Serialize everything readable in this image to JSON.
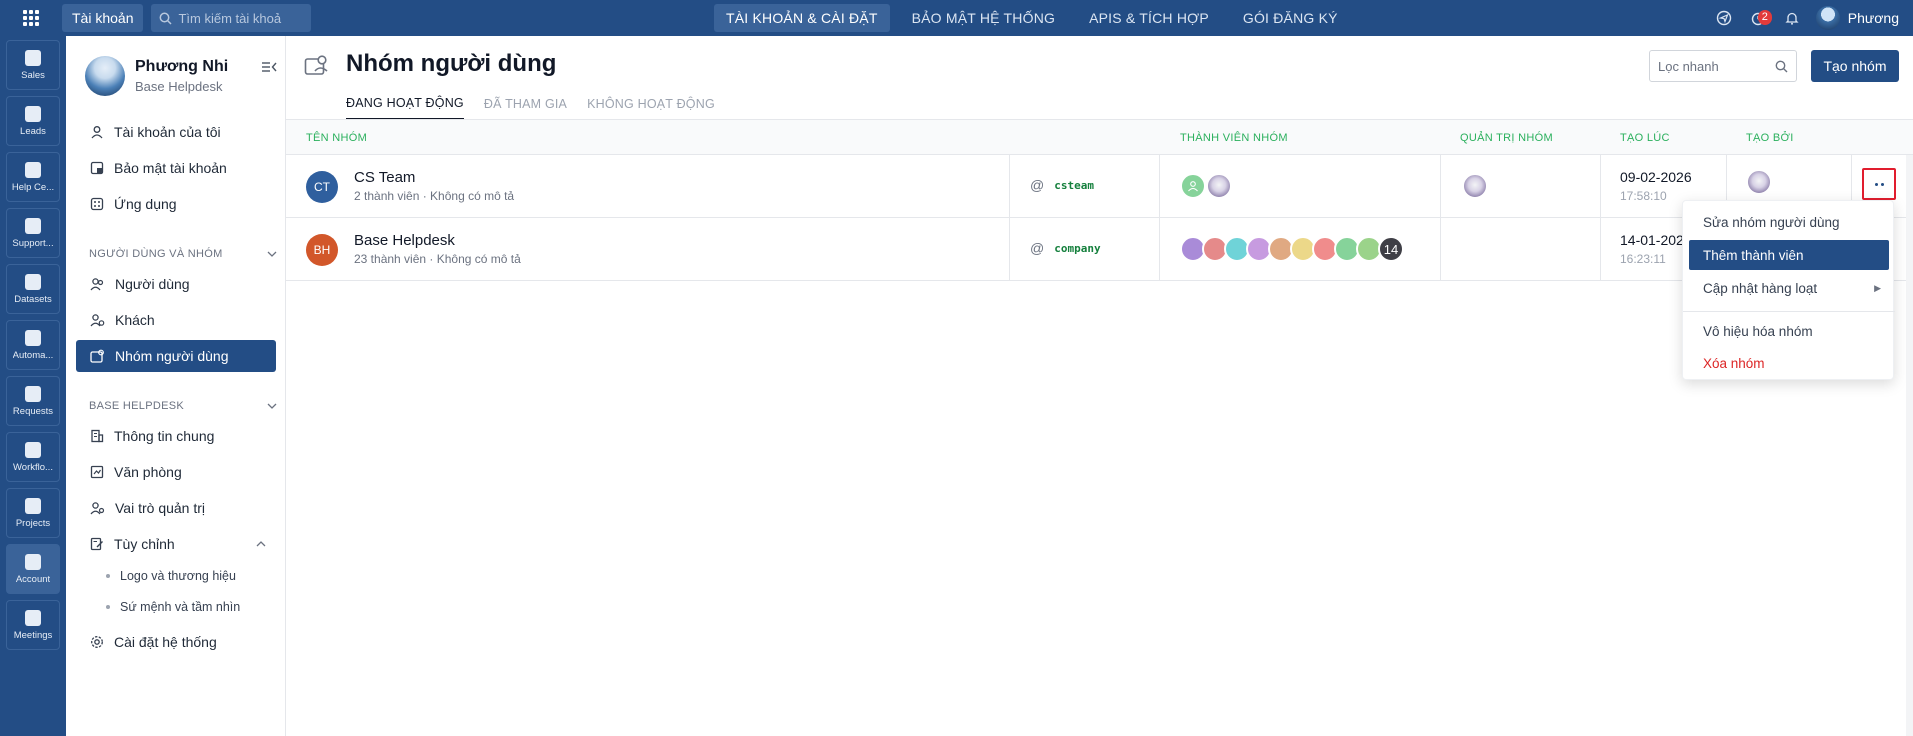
{
  "topbar": {
    "account_chip": "Tài khoản",
    "search_placeholder": "Tìm kiếm tài khoả",
    "nav": [
      {
        "label": "TÀI KHOẢN & CÀI ĐẶT",
        "active": true
      },
      {
        "label": "BẢO MẬT HỆ THỐNG",
        "active": false
      },
      {
        "label": "APIS & TÍCH HỢP",
        "active": false
      },
      {
        "label": "GÓI ĐĂNG KÝ",
        "active": false
      }
    ],
    "notification_count": "2",
    "user_name": "Phương"
  },
  "rail": [
    {
      "label": "Sales"
    },
    {
      "label": "Leads"
    },
    {
      "label": "Help Ce..."
    },
    {
      "label": "Support..."
    },
    {
      "label": "Datasets"
    },
    {
      "label": "Automa..."
    },
    {
      "label": "Requests"
    },
    {
      "label": "Workflo..."
    },
    {
      "label": "Projects"
    },
    {
      "label": "Account",
      "active": true
    },
    {
      "label": "Meetings"
    }
  ],
  "sidebar": {
    "profile_name": "Phương Nhi",
    "profile_sub": "Base Helpdesk",
    "items_top": [
      "Tài khoản của tôi",
      "Bảo mật tài khoản",
      "Ứng dụng"
    ],
    "section_users": "NGƯỜI DÙNG VÀ NHÓM",
    "items_users": [
      "Người dùng",
      "Khách",
      "Nhóm người dùng"
    ],
    "section_base": "BASE HELPDESK",
    "items_base": [
      "Thông tin chung",
      "Văn phòng",
      "Vai trò quản trị",
      "Tùy chỉnh"
    ],
    "sub_items": [
      "Logo và thương hiệu",
      "Sứ mệnh và tầm nhìn"
    ],
    "settings": "Cài đặt hệ thống"
  },
  "main": {
    "title": "Nhóm người dùng",
    "tabs": [
      "ĐANG HOẠT ĐỘNG",
      "ĐÃ THAM GIA",
      "KHÔNG HOẠT ĐỘNG"
    ],
    "quick_filter_placeholder": "Lọc nhanh",
    "create_button": "Tạo nhóm",
    "columns": {
      "name": "TÊN NHÓM",
      "members": "THÀNH VIÊN NHÓM",
      "admins": "QUẢN TRỊ NHÓM",
      "created_at": "TẠO LÚC",
      "created_by": "TẠO BỞI"
    },
    "rows": [
      {
        "initials": "CT",
        "avatar_color": "#2f5f9e",
        "name": "CS Team",
        "sub": "2 thành viên · Không có mô tả",
        "handle": "csteam",
        "date": "09-02-2026",
        "time": "17:58:10"
      },
      {
        "initials": "BH",
        "avatar_color": "#d2572a",
        "name": "Base Helpdesk",
        "sub": "23 thành viên · Không có mô tả",
        "handle": "company",
        "date": "14-01-202",
        "time": "16:23:11",
        "member_overflow": "14"
      }
    ]
  },
  "context_menu": {
    "items": [
      "Sửa nhóm người dùng",
      "Thêm thành viên",
      "Cập nhật hàng loạt",
      "Vô hiệu hóa nhóm",
      "Xóa nhóm"
    ]
  },
  "colors": {
    "brand": "#234d85",
    "column_header": "#2bb05d",
    "danger": "#dc2626"
  }
}
